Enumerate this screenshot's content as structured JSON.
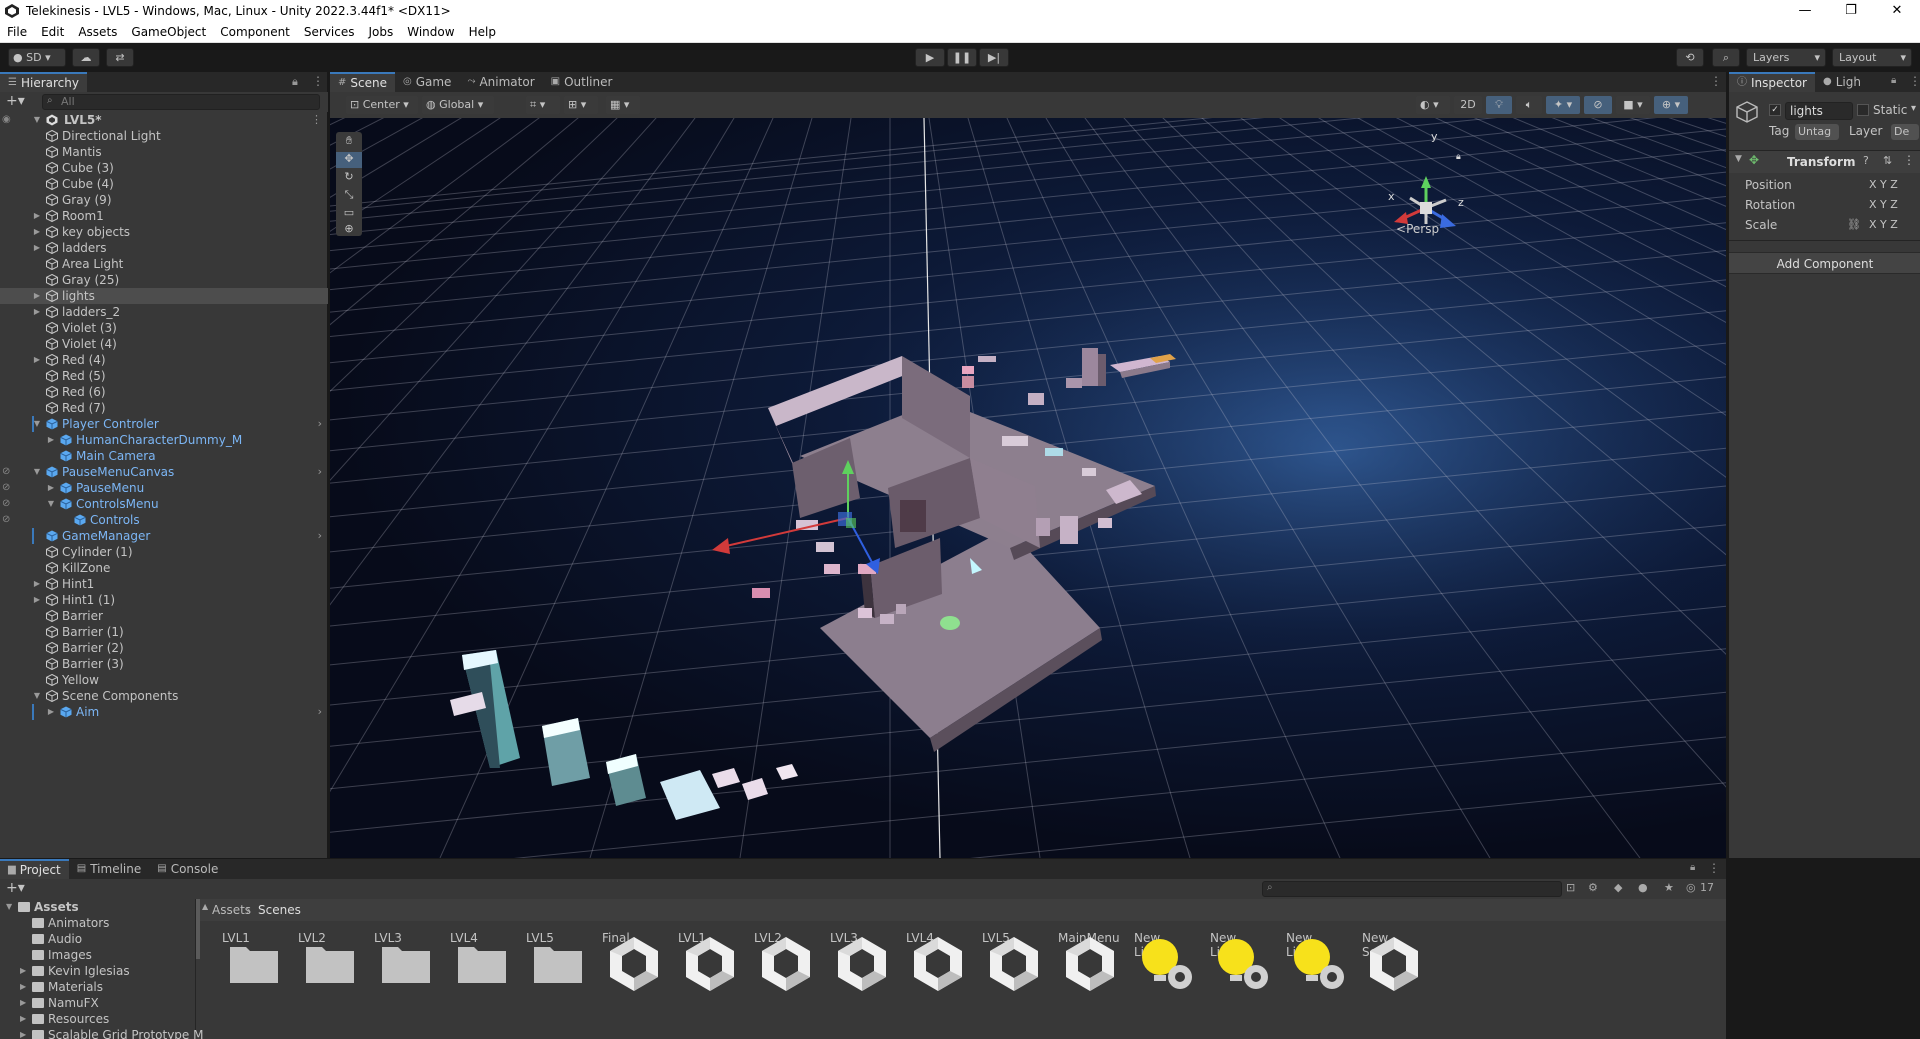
{
  "window": {
    "title": "Telekinesis - LVL5 - Windows, Mac, Linux - Unity 2022.3.44f1* <DX11>",
    "controls": [
      "—",
      "❐",
      "✕"
    ]
  },
  "menu": [
    "File",
    "Edit",
    "Assets",
    "GameObject",
    "Component",
    "Services",
    "Jobs",
    "Window",
    "Help"
  ],
  "toolbar": {
    "account": "SD",
    "layers": "Layers",
    "layout": "Layout"
  },
  "hierarchy": {
    "tab": "Hierarchy",
    "search_placeholder": "All",
    "scene": "LVL5*",
    "items": [
      {
        "label": "Directional Light",
        "depth": 1,
        "arrow": false
      },
      {
        "label": "Mantis",
        "depth": 1,
        "arrow": false
      },
      {
        "label": "Cube (3)",
        "depth": 1,
        "arrow": false
      },
      {
        "label": "Cube (4)",
        "depth": 1,
        "arrow": false
      },
      {
        "label": "Gray (9)",
        "depth": 1,
        "arrow": false
      },
      {
        "label": "Room1",
        "depth": 1,
        "arrow": true
      },
      {
        "label": "key objects",
        "depth": 1,
        "arrow": true
      },
      {
        "label": "ladders",
        "depth": 1,
        "arrow": true
      },
      {
        "label": "Area Light",
        "depth": 1,
        "arrow": false
      },
      {
        "label": "Gray (25)",
        "depth": 1,
        "arrow": false
      },
      {
        "label": "lights",
        "depth": 1,
        "arrow": true,
        "selected": true
      },
      {
        "label": "ladders_2",
        "depth": 1,
        "arrow": true
      },
      {
        "label": "Violet (3)",
        "depth": 1,
        "arrow": false
      },
      {
        "label": "Violet (4)",
        "depth": 1,
        "arrow": false
      },
      {
        "label": "Red (4)",
        "depth": 1,
        "arrow": true
      },
      {
        "label": "Red (5)",
        "depth": 1,
        "arrow": false
      },
      {
        "label": "Red (6)",
        "depth": 1,
        "arrow": false
      },
      {
        "label": "Red (7)",
        "depth": 1,
        "arrow": false
      },
      {
        "label": "Player Controler",
        "depth": 1,
        "arrow": true,
        "expanded": true,
        "blue": true,
        "chevron": true,
        "bar": true
      },
      {
        "label": "HumanCharacterDummy_M",
        "depth": 2,
        "arrow": true,
        "blue": true
      },
      {
        "label": "Main Camera",
        "depth": 2,
        "arrow": false,
        "blue": true
      },
      {
        "label": "PauseMenuCanvas",
        "depth": 1,
        "arrow": true,
        "expanded": true,
        "blue": true,
        "chevron": true,
        "eye": true
      },
      {
        "label": "PauseMenu",
        "depth": 2,
        "arrow": true,
        "blue": true,
        "eye": true
      },
      {
        "label": "ControlsMenu",
        "depth": 2,
        "arrow": true,
        "expanded": true,
        "blue": true,
        "eye": true
      },
      {
        "label": "Controls",
        "depth": 3,
        "arrow": false,
        "blue": true,
        "eye": true
      },
      {
        "label": "GameManager",
        "depth": 1,
        "arrow": false,
        "blue": true,
        "chevron": true,
        "bar": true
      },
      {
        "label": "Cylinder (1)",
        "depth": 1,
        "arrow": false
      },
      {
        "label": "KillZone",
        "depth": 1,
        "arrow": false
      },
      {
        "label": "Hint1",
        "depth": 1,
        "arrow": true
      },
      {
        "label": "Hint1 (1)",
        "depth": 1,
        "arrow": true
      },
      {
        "label": "Barrier",
        "depth": 1,
        "arrow": false
      },
      {
        "label": "Barrier (1)",
        "depth": 1,
        "arrow": false
      },
      {
        "label": "Barrier (2)",
        "depth": 1,
        "arrow": false
      },
      {
        "label": "Barrier (3)",
        "depth": 1,
        "arrow": false
      },
      {
        "label": "Yellow",
        "depth": 1,
        "arrow": false
      },
      {
        "label": "Scene Components",
        "depth": 1,
        "arrow": true,
        "expanded": true
      },
      {
        "label": "Aim",
        "depth": 2,
        "arrow": true,
        "blue": true,
        "chevron": true,
        "bar": true
      }
    ]
  },
  "scene": {
    "tabs": [
      "Scene",
      "Game",
      "Animator",
      "Outliner"
    ],
    "pivot": "Center",
    "space": "Global",
    "mode_2d": "2D",
    "projection": "Persp",
    "gizmo_axes": [
      "y",
      "x",
      "z"
    ]
  },
  "inspector": {
    "tabs": [
      "Inspector",
      "Ligh"
    ],
    "object_name": "lights",
    "static_label": "Static",
    "tag_label": "Tag",
    "tag_value": "Untag",
    "layer_label": "Layer",
    "layer_value": "De",
    "component": "Transform",
    "rows": [
      {
        "label": "Position",
        "axes": "X  Y  Z"
      },
      {
        "label": "Rotation",
        "axes": "X  Y  Z"
      },
      {
        "label": "Scale",
        "axes": "X  Y  Z"
      }
    ],
    "add_component": "Add Component"
  },
  "project": {
    "tabs": [
      "Project",
      "Timeline",
      "Console"
    ],
    "badge": "17",
    "breadcrumb": [
      "Assets",
      "Scenes"
    ],
    "folders": [
      {
        "label": "Assets",
        "depth": 0,
        "bold": true
      },
      {
        "label": "Animators",
        "depth": 1
      },
      {
        "label": "Audio",
        "depth": 1
      },
      {
        "label": "Images",
        "depth": 1
      },
      {
        "label": "Kevin Iglesias",
        "depth": 1,
        "arrow": true
      },
      {
        "label": "Materials",
        "depth": 1,
        "arrow": true
      },
      {
        "label": "NamuFX",
        "depth": 1,
        "arrow": true
      },
      {
        "label": "Resources",
        "depth": 1,
        "arrow": true
      },
      {
        "label": "Scalable Grid Prototype M",
        "depth": 1,
        "arrow": true
      }
    ],
    "assets": [
      {
        "label": "LVL1",
        "kind": "folder"
      },
      {
        "label": "LVL2",
        "kind": "folder"
      },
      {
        "label": "LVL3",
        "kind": "folder"
      },
      {
        "label": "LVL4",
        "kind": "folder"
      },
      {
        "label": "LVL5",
        "kind": "folder"
      },
      {
        "label": "Final",
        "kind": "scene"
      },
      {
        "label": "LVL1",
        "kind": "scene"
      },
      {
        "label": "LVL2",
        "kind": "scene"
      },
      {
        "label": "LVL3",
        "kind": "scene"
      },
      {
        "label": "LVL4",
        "kind": "scene"
      },
      {
        "label": "LVL5",
        "kind": "scene"
      },
      {
        "label": "MainMenu",
        "kind": "scene"
      },
      {
        "label": "New Lighti...",
        "kind": "lighting"
      },
      {
        "label": "New Lighti...",
        "kind": "lighting"
      },
      {
        "label": "New Lighti...",
        "kind": "lighting"
      },
      {
        "label": "New Scene",
        "kind": "scene"
      }
    ]
  }
}
